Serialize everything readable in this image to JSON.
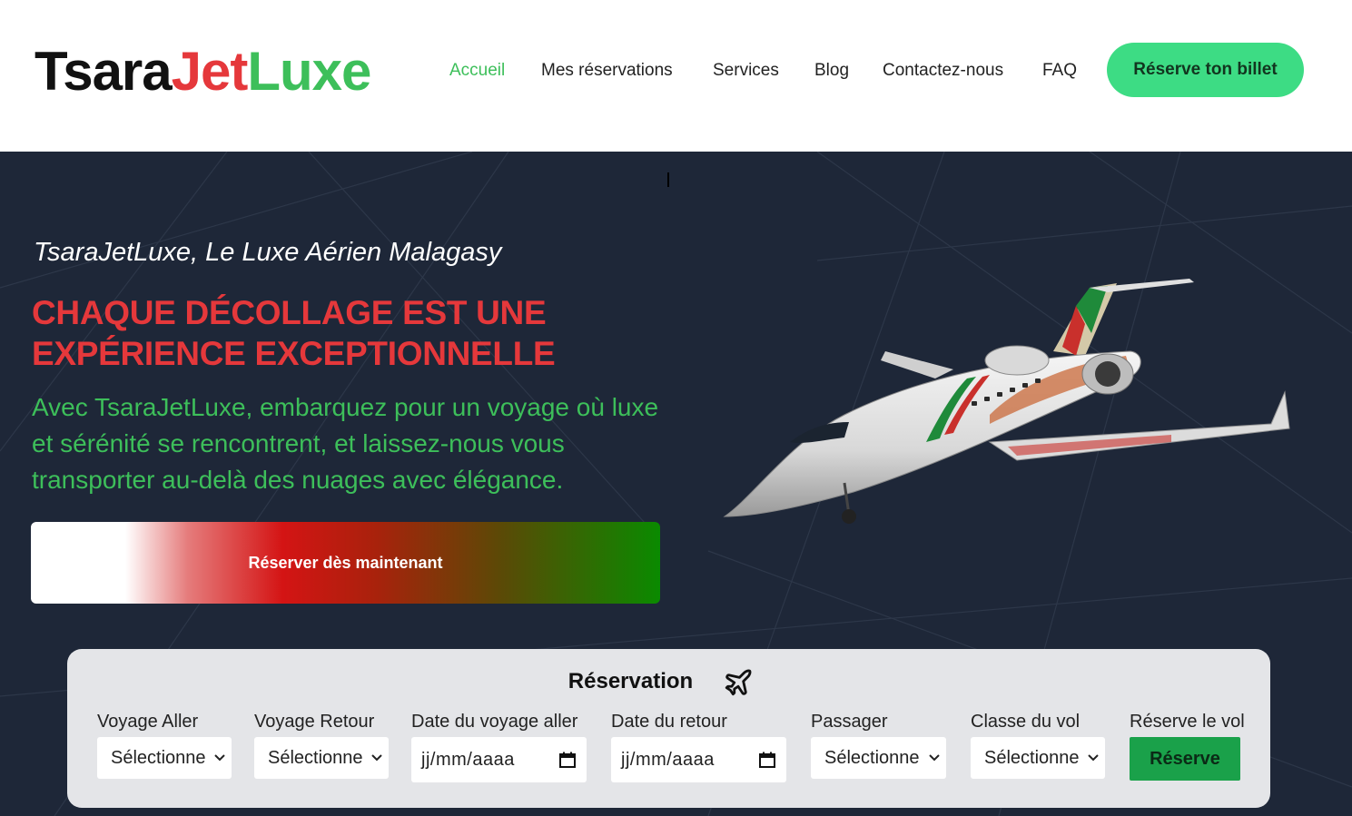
{
  "brand": {
    "part1": "Tsara",
    "part2": "Jet",
    "part3": "Luxe"
  },
  "nav": [
    {
      "label": "Accueil",
      "active": true
    },
    {
      "label": "Mes réservations"
    },
    {
      "label": "Services"
    },
    {
      "label": "Blog"
    },
    {
      "label": "Contactez-nous"
    },
    {
      "label": "FAQ"
    }
  ],
  "header_cta": "Réserve ton billet",
  "hero": {
    "tagline": "TsaraJetLuxe, Le Luxe Aérien Malagasy",
    "headline": "CHAQUE DÉCOLLAGE EST UNE EXPÉRIENCE EXCEPTIONNELLE",
    "lead": "Avec TsaraJetLuxe, embarquez pour un voyage où luxe et sérénité se rencontrent, et laissez-nous vous transporter au-delà des nuages avec élégance.",
    "button": "Réserver dès maintenant"
  },
  "reservation": {
    "title": "Réservation",
    "fields": {
      "aller": {
        "label": "Voyage Aller",
        "value": "Sélectionne"
      },
      "retour": {
        "label": "Voyage Retour",
        "value": "Sélectionne"
      },
      "date_aller": {
        "label": "Date du voyage aller",
        "value": "jj/mm/aaaa"
      },
      "date_retour": {
        "label": "Date du retour",
        "value": "jj/mm/aaaa"
      },
      "passager": {
        "label": "Passager",
        "value": "Sélectionne"
      },
      "classe": {
        "label": "Classe du vol",
        "value": "Sélectionne"
      },
      "reserve": {
        "label": "Réserve le vol",
        "button": "Réserve"
      }
    }
  },
  "colors": {
    "brand_red": "#e5383b",
    "brand_green": "#3dbf5a",
    "hero_bg": "#1e2738",
    "cta_green": "#3ddc84",
    "submit_green": "#1aa14a"
  }
}
